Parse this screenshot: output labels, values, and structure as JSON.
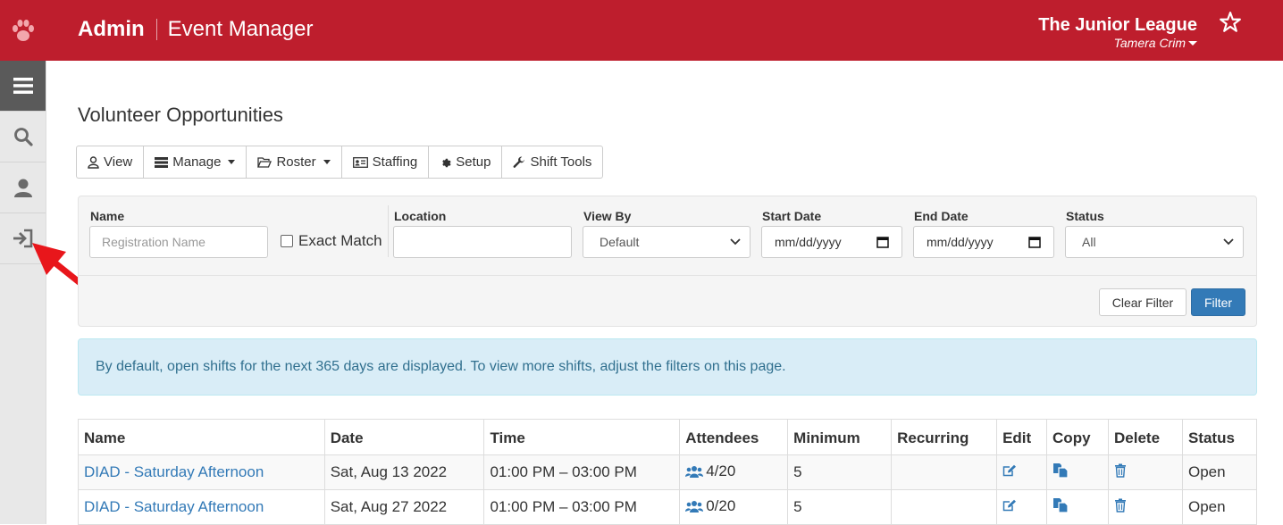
{
  "header": {
    "brand_admin": "Admin",
    "brand_app": "Event Manager",
    "org_name": "The Junior League",
    "user_name": "Tamera Crim",
    "accent_color": "#be1e2d"
  },
  "sidebar": {
    "items": [
      {
        "icon": "menu-icon",
        "active": true
      },
      {
        "icon": "search-icon"
      },
      {
        "icon": "user-icon"
      },
      {
        "icon": "sign-in-icon"
      }
    ]
  },
  "page": {
    "title": "Volunteer Opportunities"
  },
  "toolbar": {
    "view": "View",
    "manage": "Manage",
    "roster": "Roster",
    "staffing": "Staffing",
    "setup": "Setup",
    "shift_tools": "Shift Tools"
  },
  "filters": {
    "name_label": "Name",
    "name_placeholder": "Registration Name",
    "exact_match": "Exact Match",
    "location_label": "Location",
    "viewby_label": "View By",
    "viewby_value": "Default",
    "start_label": "Start Date",
    "start_value": "mm/dd/yyyy",
    "end_label": "End Date",
    "end_value": "mm/dd/yyyy",
    "status_label": "Status",
    "status_value": "All",
    "clear": "Clear Filter",
    "filter": "Filter"
  },
  "alert": "By default, open shifts for the next 365 days are displayed. To view more shifts, adjust the filters on this page.",
  "table": {
    "headers": [
      "Name",
      "Date",
      "Time",
      "Attendees",
      "Minimum",
      "Recurring",
      "Edit",
      "Copy",
      "Delete",
      "Status"
    ],
    "rows": [
      {
        "name": "DIAD - Saturday Afternoon",
        "date": "Sat, Aug 13 2022",
        "time": "01:00 PM – 03:00 PM",
        "attendees": "4/20",
        "minimum": "5",
        "recurring": "",
        "status": "Open"
      },
      {
        "name": "DIAD - Saturday Afternoon",
        "date": "Sat, Aug 27 2022",
        "time": "01:00 PM – 03:00 PM",
        "attendees": "0/20",
        "minimum": "5",
        "recurring": "",
        "status": "Open"
      }
    ]
  }
}
